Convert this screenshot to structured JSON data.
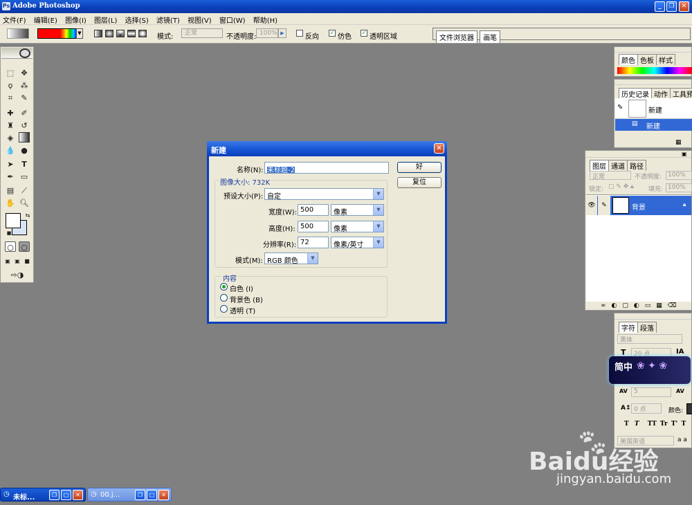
{
  "app": {
    "title": "Adobe Photoshop"
  },
  "menu": [
    "文件(F)",
    "编辑(E)",
    "图像(I)",
    "图层(L)",
    "选择(S)",
    "滤镜(T)",
    "视图(V)",
    "窗口(W)",
    "帮助(H)"
  ],
  "options": {
    "mode_label": "模式:",
    "mode_value": "正常",
    "opacity_label": "不透明度:",
    "opacity_value": "100%",
    "reverse_label": "反向",
    "dither_label": "仿色",
    "transparency_label": "透明区域",
    "palette_tabs": [
      "文件浏览器",
      "画笔"
    ]
  },
  "dialog": {
    "title": "新建",
    "name_label": "名称(N):",
    "name_value": "未标题-2",
    "ok_label": "好",
    "reset_label": "复位",
    "image_size_label": "图像大小: 732K",
    "preset_label": "预设大小(P):",
    "preset_value": "自定",
    "width_label": "宽度(W):",
    "width_value": "500",
    "width_unit": "像素",
    "height_label": "高度(H):",
    "height_value": "500",
    "height_unit": "像素",
    "resolution_label": "分辨率(R):",
    "resolution_value": "72",
    "resolution_unit": "像素/英寸",
    "mode_label": "模式(M):",
    "mode_value": "RGB 颜色",
    "contents_label": "内容",
    "contents_options": [
      {
        "label": "白色 (I)",
        "selected": true
      },
      {
        "label": "背景色 (B)",
        "selected": false
      },
      {
        "label": "透明 (T)",
        "selected": false
      }
    ]
  },
  "panels": {
    "color": {
      "tabs": [
        "颜色",
        "色板",
        "样式"
      ]
    },
    "history": {
      "tabs": [
        "历史记录",
        "动作",
        "工具预"
      ],
      "snapshot_label": "新建",
      "state_label": "新建"
    },
    "layers": {
      "tabs": [
        "图层",
        "通道",
        "路径"
      ],
      "blend_mode": "正常",
      "opacity_label": "不透明度:",
      "opacity_value": "100%",
      "lock_label": "锁定:",
      "fill_label": "填充:",
      "fill_value": "100%",
      "layer_name": "背景"
    },
    "character": {
      "tabs": [
        "字符",
        "段落"
      ],
      "font": "黑体",
      "size": "20 点",
      "tracking": "5",
      "baseline": "0 点",
      "color_label": "颜色:",
      "language": "美国英语",
      "style_buttons": [
        "T",
        "T",
        "TT",
        "Tr",
        "T'",
        "T"
      ]
    }
  },
  "taskbar": [
    {
      "label": "未标...",
      "active": true
    },
    {
      "label": "00.j...",
      "active": false
    }
  ],
  "watermark": {
    "text": "Baidu经验",
    "url": "jingyan.baidu.com",
    "sticker": "简中"
  },
  "colors": {
    "title_bar": "#0a3fb8",
    "workspace": "#808080",
    "panel_bg": "#ece9d8",
    "selected_row": "#3168d5"
  }
}
